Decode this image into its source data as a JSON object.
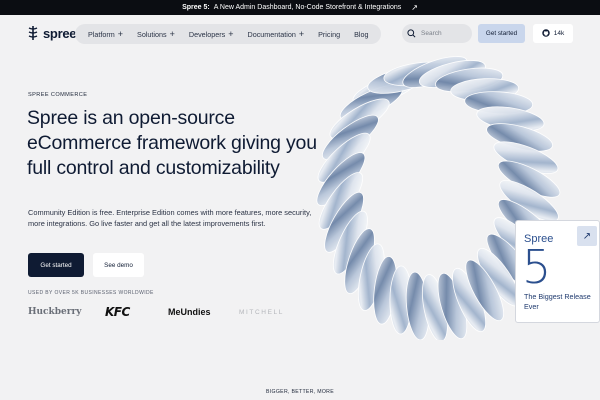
{
  "announcement": {
    "bold": "Spree 5:",
    "text": "A New Admin Dashboard, No-Code Storefront & Integrations",
    "arrow_icon": "arrow-up-right-icon"
  },
  "header": {
    "logo_text": "spree",
    "nav": [
      {
        "label": "Platform",
        "has_plus": true
      },
      {
        "label": "Solutions",
        "has_plus": true
      },
      {
        "label": "Developers",
        "has_plus": true
      },
      {
        "label": "Documentation",
        "has_plus": true
      },
      {
        "label": "Pricing",
        "has_plus": false
      },
      {
        "label": "Blog",
        "has_plus": false
      }
    ],
    "search_placeholder": "Search",
    "cta_label": "Get started",
    "github_stars": "14k"
  },
  "hero": {
    "eyebrow": "SPREE COMMERCE",
    "headline": "Spree is an open-source eCommerce framework giving you full control and customizability",
    "subtext": "Community Edition is free. Enterprise Edition comes with more features, more security, more integrations. Go live faster and get all the latest improvements first.",
    "primary_button": "Get started",
    "secondary_button": "See demo",
    "used_by": "USED BY OVER 5K BUSINESSES WORLDWIDE",
    "brands": [
      "Huckberry",
      "KFC",
      "MeUndies",
      "MITCHELL"
    ]
  },
  "card": {
    "title": "Spree",
    "number": "5",
    "subtitle": "The Biggest Release Ever"
  },
  "footer_tag": "BIGGER, BETTER, MORE",
  "colors": {
    "background": "#f2f2f3",
    "navy": "#0f1b33",
    "accent_blue": "#2b4f8e",
    "button_light_blue": "#c9d6ec"
  }
}
